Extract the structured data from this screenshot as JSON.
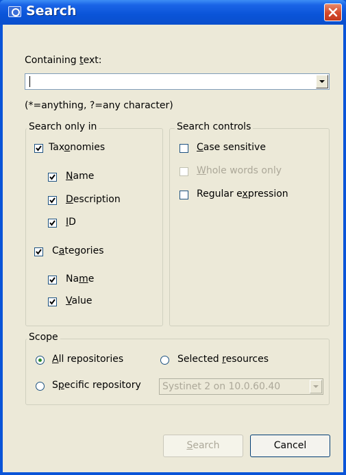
{
  "window": {
    "title": "Search"
  },
  "containing_text": {
    "label": "Containing text:",
    "underline_char": "t",
    "value": "",
    "hint": "(*=anything, ?=any character)"
  },
  "search_only_in": {
    "title": "Search only in",
    "taxonomies": {
      "label": "Taxonomies",
      "checked": true
    },
    "taxonomy_name": {
      "label": "Name",
      "checked": true
    },
    "taxonomy_description": {
      "label": "Description",
      "checked": true
    },
    "taxonomy_id": {
      "label": "ID",
      "checked": true
    },
    "categories": {
      "label": "Categories",
      "checked": true
    },
    "category_name": {
      "label": "Name",
      "checked": true
    },
    "category_value": {
      "label": "Value",
      "checked": true
    }
  },
  "search_controls": {
    "title": "Search controls",
    "case_sensitive": {
      "label": "Case sensitive",
      "checked": false
    },
    "whole_words": {
      "label": "Whole words only",
      "checked": false,
      "disabled": true
    },
    "regular_expression": {
      "label": "Regular expression",
      "checked": false
    }
  },
  "scope": {
    "title": "Scope",
    "all_repositories": {
      "label": "All repositories",
      "selected": true
    },
    "selected_resources": {
      "label": "Selected resources",
      "selected": false
    },
    "specific_repository": {
      "label": "Specific repository",
      "selected": false
    },
    "repository_select": {
      "value": "Systinet 2 on 10.0.60.40",
      "disabled": true
    }
  },
  "buttons": {
    "search": {
      "label": "Search",
      "disabled": true
    },
    "cancel": {
      "label": "Cancel"
    }
  }
}
